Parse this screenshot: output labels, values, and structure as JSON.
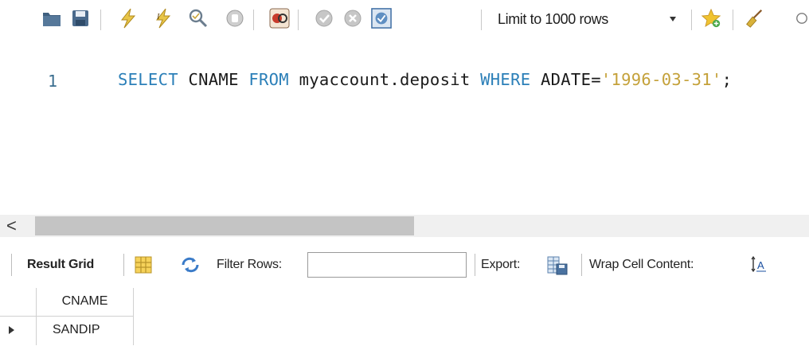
{
  "toolbar": {
    "icons": [
      "open-folder-icon",
      "save-icon",
      "execute-lightning-icon",
      "execute-current-lightning-icon",
      "explain-magnifier-icon",
      "stop-icon",
      "toggle-error-continue-icon",
      "commit-icon",
      "rollback-icon",
      "autocommit-toggle-icon",
      "add-snippet-star-icon",
      "beautify-broom-icon",
      "find-icon"
    ],
    "limit_label": "Limit to 1000 rows"
  },
  "editor": {
    "line_number": "1",
    "tokens": {
      "select_kw": "SELECT",
      "column": " CNAME ",
      "from_kw": "FROM",
      "table": " myaccount.deposit ",
      "where_kw": "WHERE",
      "condition": " ADATE=",
      "date_literal": "'1996-03-31'",
      "terminator": ";"
    },
    "colors": {
      "keyword": "#2b7fb8",
      "string": "#c4a13a",
      "text": "#1a1a1a",
      "line_number": "#3a6e8f"
    }
  },
  "scrollbar": {
    "arrow": "<"
  },
  "result_toolbar": {
    "result_grid_label": "Result Grid",
    "filter_rows_label": "Filter Rows:",
    "filter_value": "",
    "export_label": "Export:",
    "wrap_label": "Wrap Cell Content:"
  },
  "grid": {
    "columns": [
      "CNAME"
    ],
    "rows": [
      [
        "SANDIP"
      ]
    ]
  }
}
